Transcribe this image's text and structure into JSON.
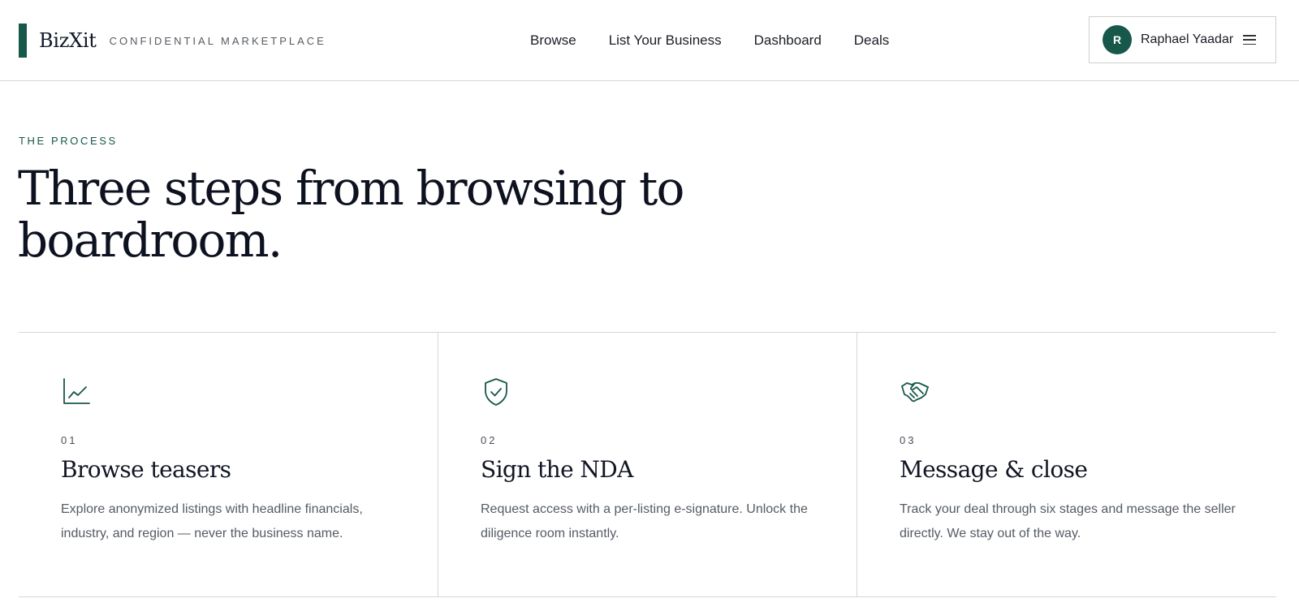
{
  "header": {
    "brand_name": "BizXit",
    "brand_tagline": "CONFIDENTIAL MARKETPLACE",
    "nav": [
      {
        "label": "Browse"
      },
      {
        "label": "List Your Business"
      },
      {
        "label": "Dashboard"
      },
      {
        "label": "Deals"
      }
    ],
    "user": {
      "initial": "R",
      "name": "Raphael Yaadar"
    }
  },
  "hero": {
    "eyebrow": "THE PROCESS",
    "title": "Three steps from browsing to boardroom."
  },
  "steps": [
    {
      "icon": "line-chart-icon",
      "number": "01",
      "title": "Browse teasers",
      "text": "Explore anonymized listings with headline financials, industry, and region — never the business name."
    },
    {
      "icon": "shield-check-icon",
      "number": "02",
      "title": "Sign the NDA",
      "text": "Request access with a per-listing e-signature. Unlock the diligence room instantly."
    },
    {
      "icon": "handshake-icon",
      "number": "03",
      "title": "Message & close",
      "text": "Track your deal through six stages and message the seller directly. We stay out of the way."
    }
  ],
  "colors": {
    "accent": "#17584a",
    "text": "#14171f",
    "muted": "#555b64",
    "border": "#d6d6d6"
  }
}
